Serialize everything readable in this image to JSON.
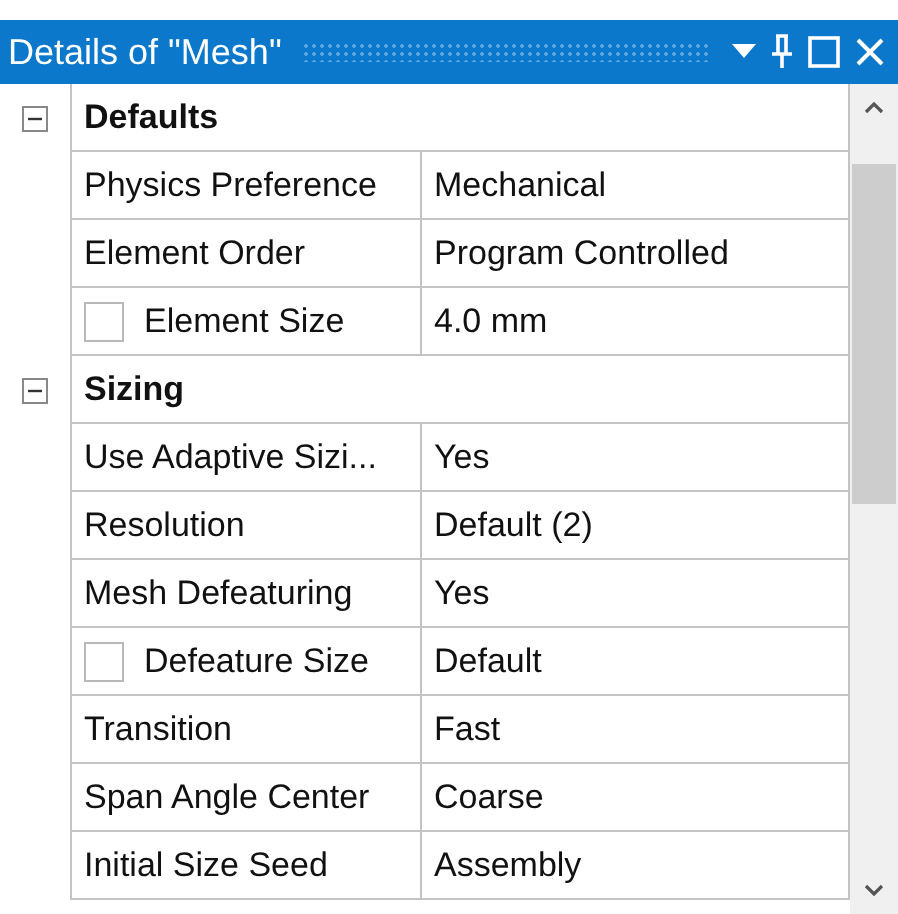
{
  "panel": {
    "title": "Details of \"Mesh\""
  },
  "groups": [
    {
      "label": "Defaults",
      "expanded": true,
      "rows": [
        {
          "kind": "plain",
          "name": "Physics Preference",
          "value": "Mechanical"
        },
        {
          "kind": "plain",
          "name": "Element Order",
          "value": "Program Controlled"
        },
        {
          "kind": "checkbox",
          "checked": false,
          "name": "Element Size",
          "value": "4.0 mm"
        }
      ]
    },
    {
      "label": "Sizing",
      "expanded": true,
      "rows": [
        {
          "kind": "plain",
          "name": "Use Adaptive Sizi...",
          "value": "Yes"
        },
        {
          "kind": "plain",
          "name": "Resolution",
          "value": "Default (2)"
        },
        {
          "kind": "plain",
          "name": "Mesh Defeaturing",
          "value": "Yes"
        },
        {
          "kind": "checkbox",
          "checked": false,
          "name": "Defeature Size",
          "value": "Default"
        },
        {
          "kind": "plain",
          "name": "Transition",
          "value": "Fast"
        },
        {
          "kind": "plain",
          "name": "Span Angle Center",
          "value": "Coarse"
        },
        {
          "kind": "plain",
          "name": "Initial Size Seed",
          "value": "Assembly"
        }
      ]
    }
  ]
}
